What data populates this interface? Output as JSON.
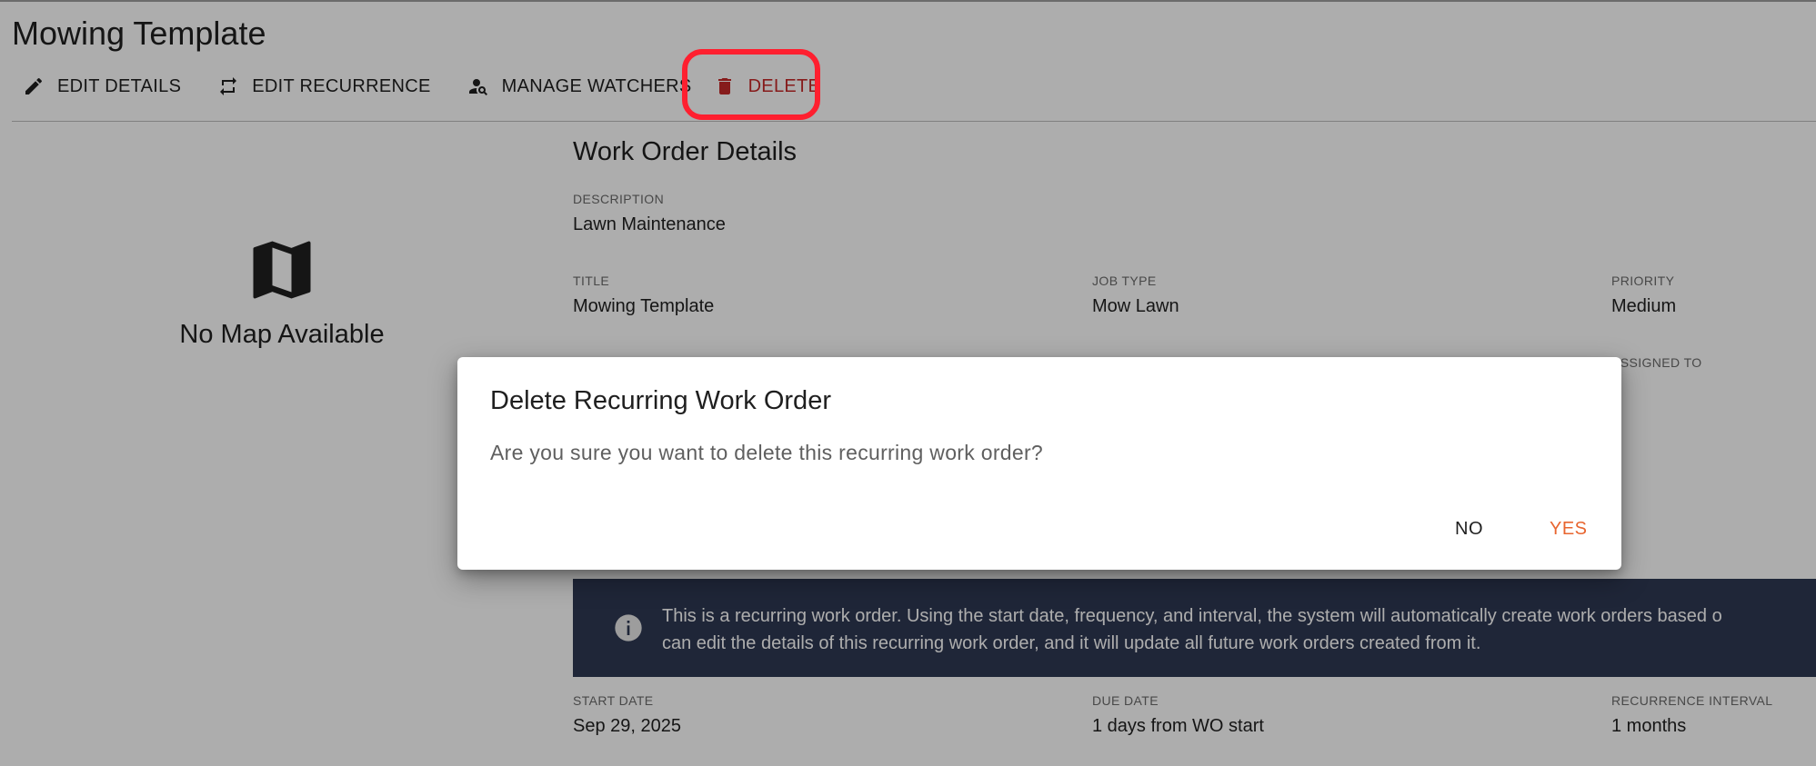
{
  "page": {
    "title": "Mowing Template"
  },
  "toolbar": {
    "edit_details": "EDIT DETAILS",
    "edit_recurrence": "EDIT RECURRENCE",
    "manage_watchers": "MANAGE WATCHERS",
    "delete": "DELETE"
  },
  "map": {
    "empty_text": "No Map Available",
    "icon": "map-icon"
  },
  "details": {
    "section_title": "Work Order Details",
    "description_label": "DESCRIPTION",
    "description_value": "Lawn Maintenance",
    "title_label": "TITLE",
    "title_value": "Mowing Template",
    "job_type_label": "JOB TYPE",
    "job_type_value": "Mow Lawn",
    "priority_label": "PRIORITY",
    "priority_value": "Medium",
    "assigned_to_label": "ASSIGNED TO",
    "start_date_label": "START DATE",
    "start_date_value": "Sep 29, 2025",
    "due_date_label": "DUE DATE",
    "due_date_value": "1 days from WO start",
    "recurrence_interval_label": "RECURRENCE INTERVAL",
    "recurrence_interval_value": "1 months"
  },
  "info_banner": {
    "line1": "This is a recurring work order. Using the start date, frequency, and interval, the system will automatically create work orders based o",
    "line2": "can edit the details of this recurring work order, and it will update all future work orders created from it."
  },
  "dialog": {
    "title": "Delete Recurring Work Order",
    "message": "Are you sure you want to delete this recurring work order?",
    "no_label": "NO",
    "yes_label": "YES"
  },
  "colors": {
    "delete": "#c62828",
    "confirm": "#e8652f",
    "banner": "#2f3853",
    "annotation": "#ff1f2f"
  }
}
